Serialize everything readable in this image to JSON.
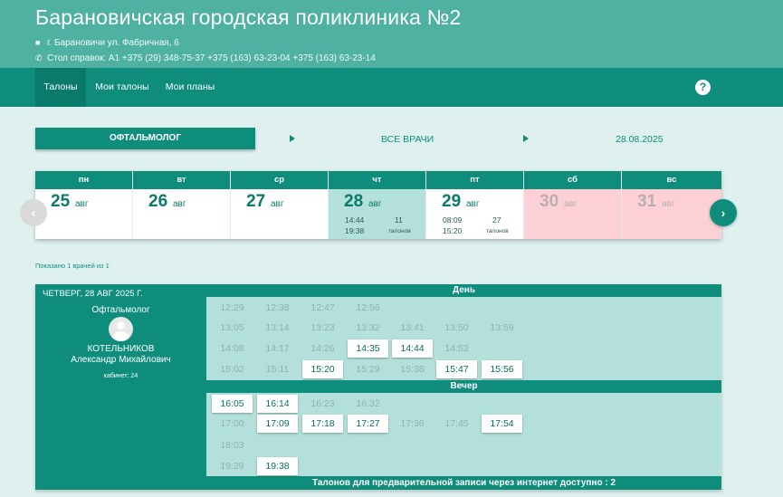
{
  "header": {
    "title": "Барановичская городская поликлиника №2",
    "address": "г. Барановичи ул. Фабричная, 6",
    "phone": "Стол справок: А1 +375 (29) 348-75-37 +375 (163) 63-23-04 +375 (163) 63-23-14"
  },
  "nav": {
    "tabs": [
      "Талоны",
      "Мои талоны",
      "Мои планы"
    ],
    "help": "?"
  },
  "filters": {
    "specialty": "ОФТАЛЬМОЛОГ",
    "doctors": "ВСЕ ВРАЧИ",
    "date": "28.08.2025"
  },
  "calendar": {
    "days": [
      {
        "dname": "пн",
        "num": "25",
        "mon": "авг"
      },
      {
        "dname": "вт",
        "num": "26",
        "mon": "авг"
      },
      {
        "dname": "ср",
        "num": "27",
        "mon": "авг"
      },
      {
        "dname": "чт",
        "num": "28",
        "mon": "авг",
        "t1": "14:44",
        "t2": "19:38",
        "count": "11",
        "tal": "талонов"
      },
      {
        "dname": "пт",
        "num": "29",
        "mon": "авг",
        "t1": "08:09",
        "t2": "15:20",
        "count": "27",
        "tal": "талонов"
      },
      {
        "dname": "сб",
        "num": "30",
        "mon": "авг"
      },
      {
        "dname": "вс",
        "num": "31",
        "mon": "авг"
      }
    ],
    "prev": "‹",
    "next": "›"
  },
  "shown": "Показано 1 врачей из 1",
  "schedule": {
    "date": "ЧЕТВЕРГ, 28 АВГ 2025 Г.",
    "specialty": "Офтальмолог",
    "last_name": "КОТЕЛЬНИКОВ",
    "first_name": "Александр Михайлович",
    "cabinet": "кабинет: 24",
    "day_label": "День",
    "evening_label": "Вечер",
    "footer": "Талонов для предварительной записи через интернет доступно : 2",
    "day_slots": [
      [
        "12:29",
        "12:38",
        "12:47",
        "12:56"
      ],
      [
        "13:05",
        "13:14",
        "13:23",
        "13:32",
        "13:41",
        "13:50",
        "13:59"
      ],
      [
        "14:08",
        "14:17",
        "14:26",
        "14:35",
        "14:44",
        "14:53"
      ],
      [
        "15:02",
        "15:11",
        "15:20",
        "15:29",
        "15:38",
        "15:47",
        "15:56"
      ]
    ],
    "evening_slots": [
      [
        "16:05",
        "16:14",
        "16:23",
        "16:32"
      ],
      [
        "17:00",
        "17:09",
        "17:18",
        "17:27",
        "17:36",
        "17:45",
        "17:54"
      ],
      [
        "18:03"
      ],
      [
        "19:29",
        "19:38"
      ]
    ],
    "free_slots": [
      "14:35",
      "14:44",
      "15:20",
      "15:47",
      "15:56",
      "16:05",
      "16:14",
      "17:09",
      "17:18",
      "17:27",
      "17:54",
      "19:38"
    ]
  }
}
